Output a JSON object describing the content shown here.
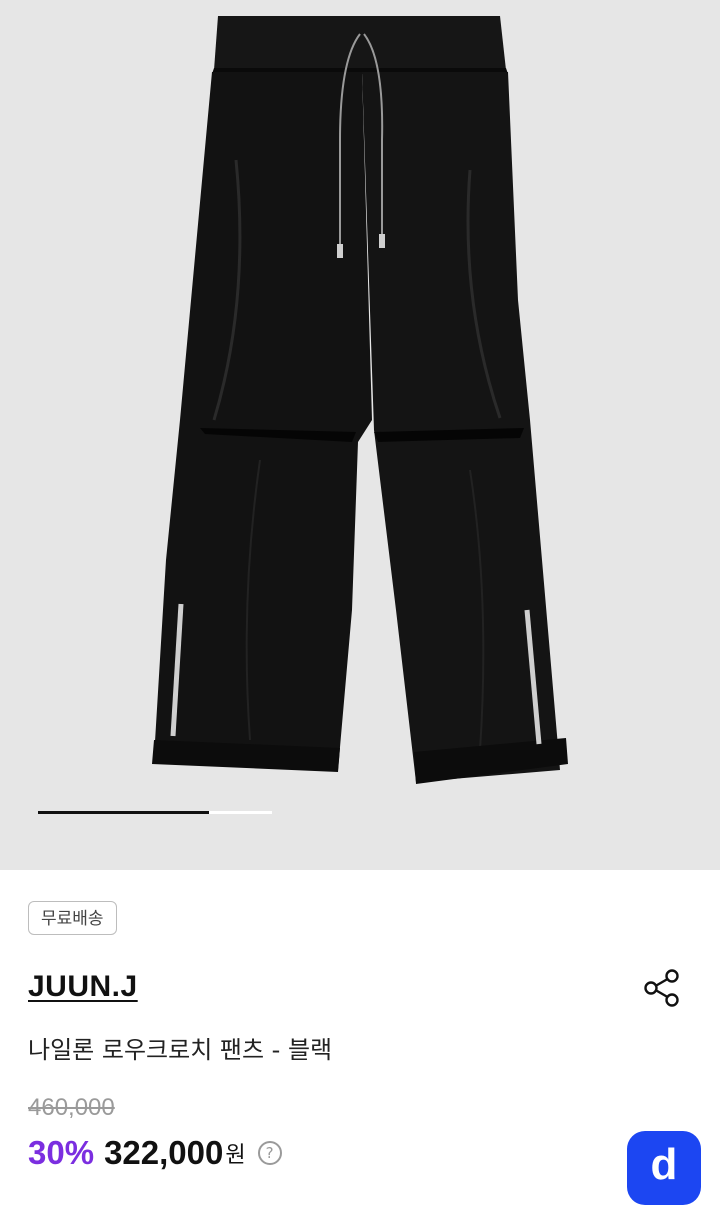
{
  "gallery": {
    "image_alt": "black nylon low crotch pants",
    "slide_progress": 0.73
  },
  "badge": {
    "label": "무료배송"
  },
  "product": {
    "brand": "JUUN.J",
    "name": "나일론 로우크로치 팬츠 - 블랙",
    "original_price": "460,000",
    "discount": "30%",
    "sale_price": "322,000",
    "currency": "원"
  },
  "icons": {
    "share": "share-icon",
    "help": "help-icon",
    "app": "app-launcher-icon"
  },
  "colors": {
    "accent_discount": "#7b2ee0",
    "fab_blue": "#1c46f2",
    "gallery_bg": "#e6e6e6"
  },
  "fab": {
    "glyph": "d"
  },
  "help": {
    "glyph": "?"
  }
}
